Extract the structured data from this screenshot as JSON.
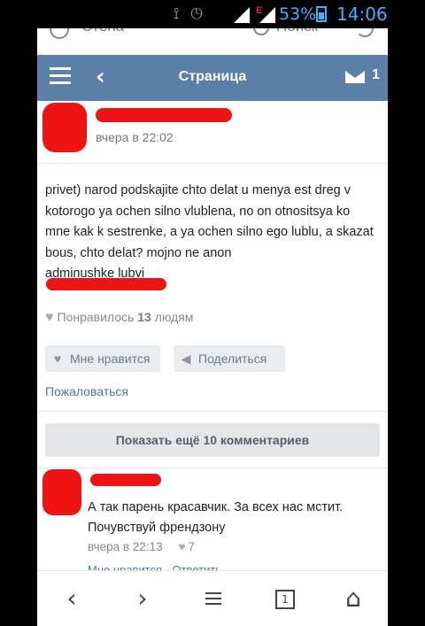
{
  "status_bar": {
    "battery_percent": "53%",
    "time": "14:06",
    "network_badge": "E"
  },
  "top_partial": {
    "wall_label": "Стена",
    "search_label": "Поиск"
  },
  "header": {
    "title": "Страница",
    "mail_count": "1"
  },
  "post": {
    "time": "вчера в 22:02",
    "text_lines": [
      "privet) narod podskajite chto delat u menya est dreg v",
      "kotorogo ya ochen silno vlublena, no on otnositsya ko",
      "mne kak k sestrenke, a ya ochen silno ego lublu, a skazat",
      "bous, chto delat? mojno ne anon",
      "adminushke lubvi"
    ],
    "likes_prefix": "Понравилось",
    "likes_count": "13",
    "likes_suffix": "людям",
    "like_button": "Мне нравится",
    "share_button": "Поделиться",
    "report_link": "Пожаловаться"
  },
  "comments": {
    "more_button": "Показать ещё 10 комментариев",
    "items": [
      {
        "text_lines": [
          "А так парень красавчик. За всех нас мстит.",
          "Почувствуй френдзону"
        ],
        "time": "вчера в 22:13",
        "likes": "7",
        "actions": "Мне нравится · Ответить"
      }
    ]
  },
  "colors": {
    "header_bg": "#5b7fa6",
    "link": "#4d78a6",
    "redaction": "#ee1414",
    "status_accent": "#3bb3ff"
  }
}
